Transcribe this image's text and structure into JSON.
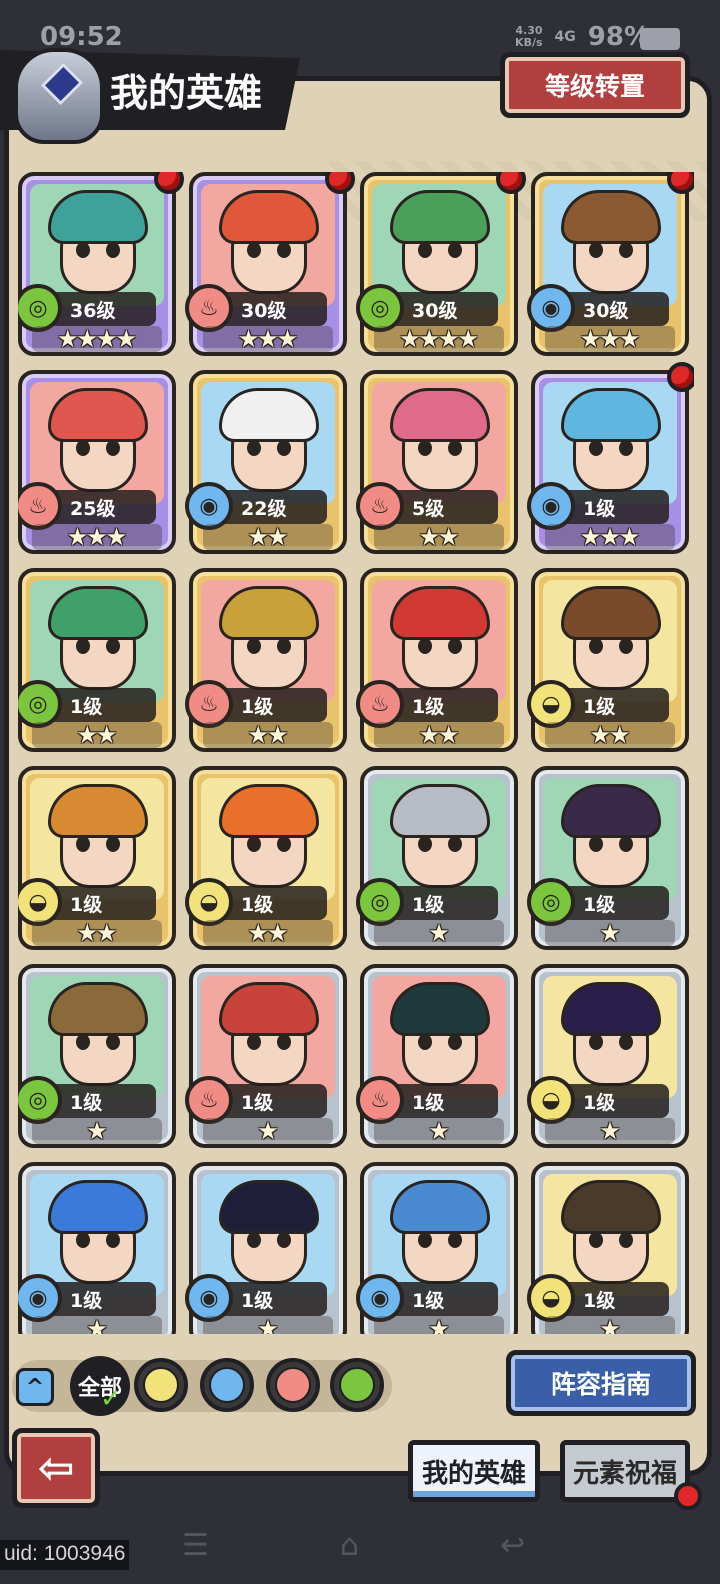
{
  "status": {
    "time": "09:52",
    "net_speed": "4.30",
    "net_unit": "KB/s",
    "signal": "4G",
    "battery": "98%"
  },
  "header": {
    "title": "我的英雄",
    "level_transfer_button": "等级转置"
  },
  "heroes": [
    {
      "level": "36级",
      "stars": 4,
      "element": "wind",
      "frame": "purple",
      "new": true,
      "hair": "#3fa29a"
    },
    {
      "level": "30级",
      "stars": 3,
      "element": "fire",
      "frame": "purple",
      "new": true,
      "hair": "#e0573a"
    },
    {
      "level": "30级",
      "stars": 4,
      "element": "wind",
      "frame": "gold",
      "new": true,
      "hair": "#4aa05a"
    },
    {
      "level": "30级",
      "stars": 3,
      "element": "water",
      "frame": "gold",
      "new": true,
      "hair": "#8c5a32"
    },
    {
      "level": "25级",
      "stars": 3,
      "element": "fire",
      "frame": "purple",
      "new": false,
      "hair": "#e0574f"
    },
    {
      "level": "22级",
      "stars": 2,
      "element": "water",
      "frame": "gold",
      "new": false,
      "hair": "#f0f0f0"
    },
    {
      "level": "5级",
      "stars": 2,
      "element": "fire",
      "frame": "gold",
      "new": false,
      "hair": "#e06a8a"
    },
    {
      "level": "1级",
      "stars": 3,
      "element": "water",
      "frame": "purple",
      "new": true,
      "hair": "#5fb7e0"
    },
    {
      "level": "1级",
      "stars": 2,
      "element": "wind",
      "frame": "gold",
      "new": false,
      "hair": "#3fa06a"
    },
    {
      "level": "1级",
      "stars": 2,
      "element": "fire",
      "frame": "gold",
      "new": false,
      "hair": "#c9a03a"
    },
    {
      "level": "1级",
      "stars": 2,
      "element": "fire",
      "frame": "gold",
      "new": false,
      "hair": "#d03a32"
    },
    {
      "level": "1级",
      "stars": 2,
      "element": "earth",
      "frame": "gold",
      "new": false,
      "hair": "#7a4a2a"
    },
    {
      "level": "1级",
      "stars": 2,
      "element": "earth",
      "frame": "gold",
      "new": false,
      "hair": "#d88a32"
    },
    {
      "level": "1级",
      "stars": 2,
      "element": "earth",
      "frame": "gold",
      "new": false,
      "hair": "#e8702a"
    },
    {
      "level": "1级",
      "stars": 1,
      "element": "wind",
      "frame": "silver",
      "new": false,
      "hair": "#b8bcc4"
    },
    {
      "level": "1级",
      "stars": 1,
      "element": "wind",
      "frame": "silver",
      "new": false,
      "hair": "#3a2a4a"
    },
    {
      "level": "1级",
      "stars": 1,
      "element": "wind",
      "frame": "silver",
      "new": false,
      "hair": "#8a6a3a"
    },
    {
      "level": "1级",
      "stars": 1,
      "element": "fire",
      "frame": "silver",
      "new": false,
      "hair": "#c8433a"
    },
    {
      "level": "1级",
      "stars": 1,
      "element": "fire",
      "frame": "silver",
      "new": false,
      "hair": "#1e3a3a"
    },
    {
      "level": "1级",
      "stars": 1,
      "element": "earth",
      "frame": "silver",
      "new": false,
      "hair": "#2a1e4a"
    },
    {
      "level": "1级",
      "stars": 1,
      "element": "water",
      "frame": "silver",
      "new": false,
      "hair": "#3a7ad8"
    },
    {
      "level": "1级",
      "stars": 1,
      "element": "water",
      "frame": "silver",
      "new": false,
      "hair": "#1e1e3a"
    },
    {
      "level": "1级",
      "stars": 1,
      "element": "water",
      "frame": "silver",
      "new": false,
      "hair": "#4a8ad0"
    },
    {
      "level": "1级",
      "stars": 1,
      "element": "earth",
      "frame": "silver",
      "new": false,
      "hair": "#4a3a2a"
    }
  ],
  "filters": {
    "all_label": "全部",
    "items": [
      "earth",
      "water",
      "fire",
      "wind"
    ]
  },
  "lineup_guide_button": "阵容指南",
  "tabs": {
    "my_heroes": "我的英雄",
    "element_blessing": "元素祝福"
  },
  "footer": {
    "uid": "uid: 1003946"
  },
  "colors": {
    "wind": "#7bc63e",
    "fire": "#f08c85",
    "water": "#6fb7ee",
    "earth": "#f1e27a",
    "accent_red": "#b23f3f",
    "accent_blue": "#3a5fa8"
  }
}
